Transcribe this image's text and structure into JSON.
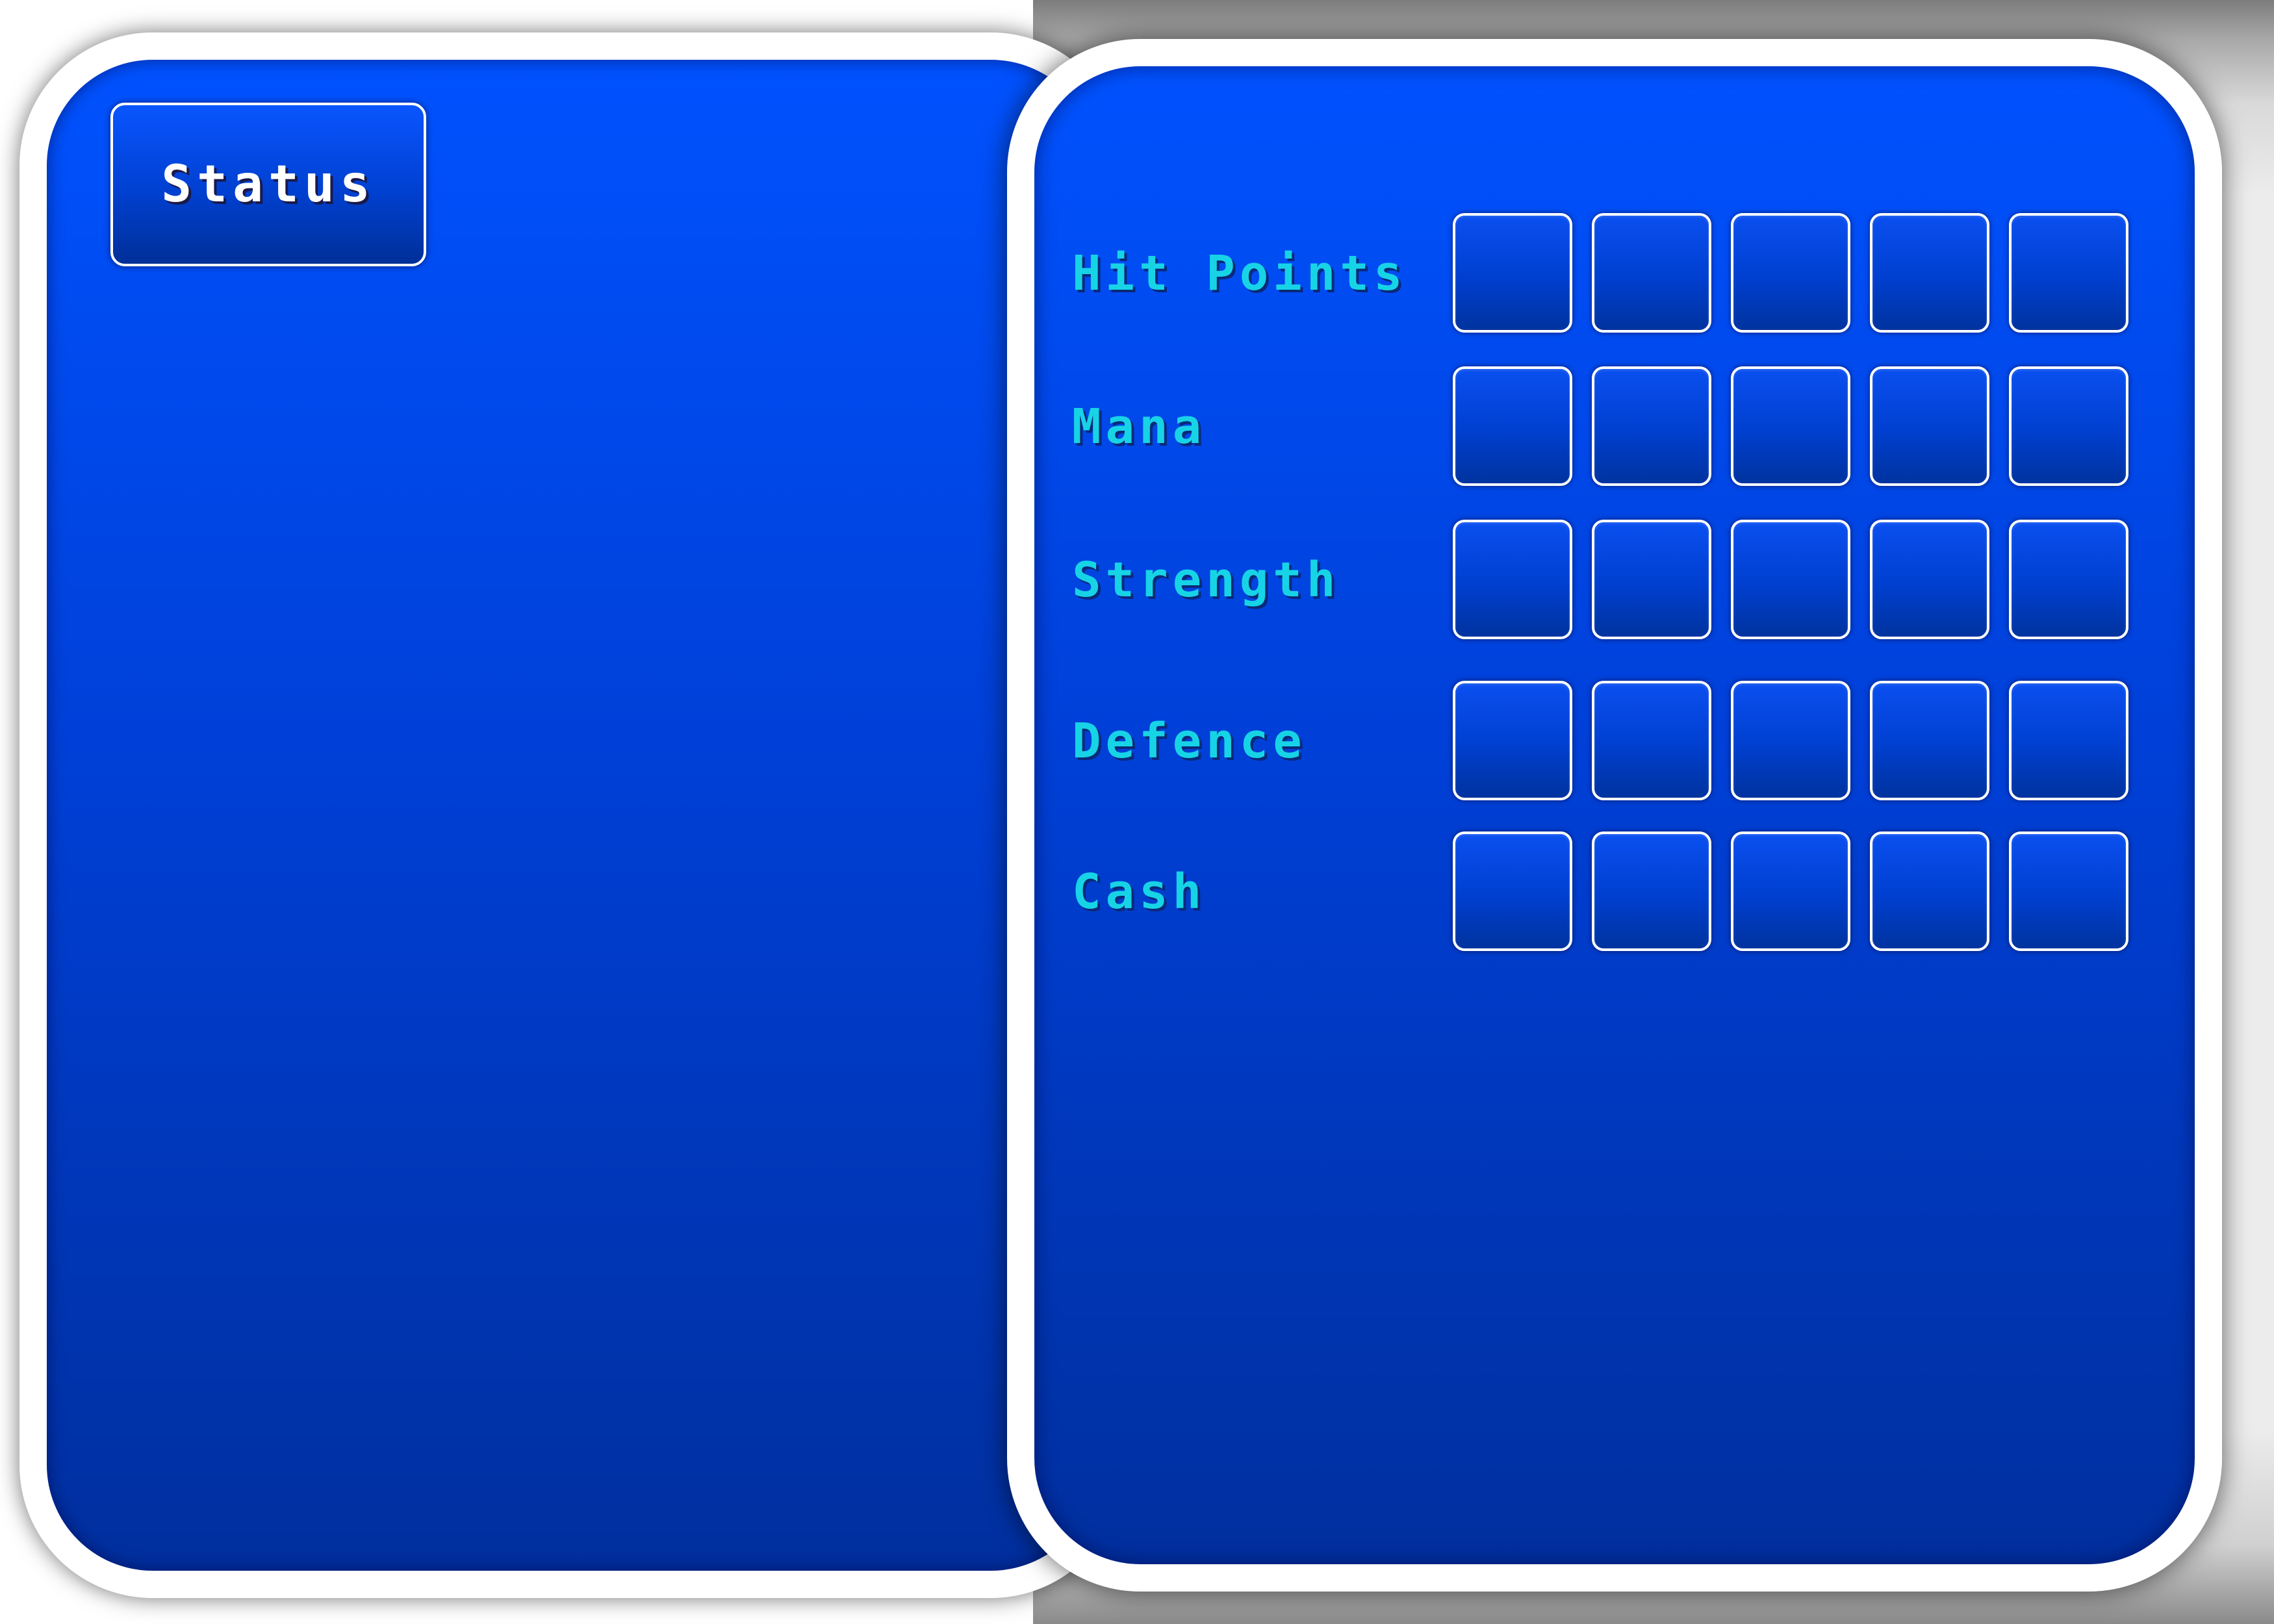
{
  "menu": {
    "status_label": "Status"
  },
  "stats": [
    {
      "label": "Hit Points",
      "slots": 5
    },
    {
      "label": "Mana",
      "slots": 5
    },
    {
      "label": "Strength",
      "slots": 5
    },
    {
      "label": "Defence",
      "slots": 5
    },
    {
      "label": "Cash",
      "slots": 5
    }
  ],
  "colors": {
    "panel_blue": "#0046e0",
    "label_cyan": "#17d3e6",
    "frame_white": "#ffffff"
  }
}
